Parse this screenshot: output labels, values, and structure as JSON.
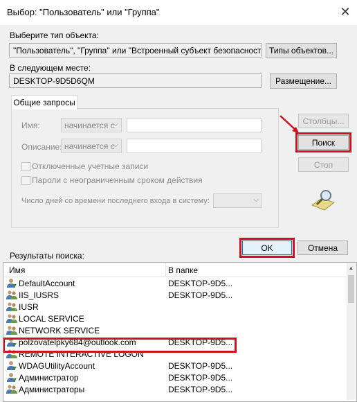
{
  "window": {
    "title": "Выбор: \"Пользователь\" или \"Группа\"",
    "close_glyph": "✕"
  },
  "object_type": {
    "label": "Выберите тип объекта:",
    "value": "\"Пользователь\", \"Группа\" или \"Встроенный субъект безопасности\"",
    "button": "Типы объектов..."
  },
  "location": {
    "label": "В следующем месте:",
    "value": "DESKTOP-9D5D6QM",
    "button": "Размещение..."
  },
  "queries": {
    "tab_label": "Общие запросы",
    "name_label": "Имя:",
    "name_mode": "начинается с",
    "description_label": "Описание:",
    "description_mode": "начинается с",
    "disabled_accounts": "Отключенные учетные записи",
    "non_expiring_passwords": "Пароли с неограниченным сроком действия",
    "days_since_logon": "Число дней со времени последнего входа в систему:",
    "dropdown_arrow": "⌵"
  },
  "side_buttons": {
    "columns": "Столбцы...",
    "search": "Поиск",
    "stop": "Стоп"
  },
  "dialog_buttons": {
    "ok": "OK",
    "cancel": "Отмена"
  },
  "results": {
    "label": "Результаты поиска:",
    "col_name": "Имя",
    "col_folder": "В папке",
    "rows": [
      {
        "name": "DefaultAccount",
        "folder": "DESKTOP-9D5...",
        "icon": "user-icon"
      },
      {
        "name": "IIS_IUSRS",
        "folder": "DESKTOP-9D5...",
        "icon": "group-icon"
      },
      {
        "name": "IUSR",
        "folder": "",
        "icon": "group-icon"
      },
      {
        "name": "LOCAL SERVICE",
        "folder": "",
        "icon": "group-icon"
      },
      {
        "name": "NETWORK SERVICE",
        "folder": "",
        "icon": "group-icon"
      },
      {
        "name": "polzovatelpky684@outlook.com",
        "folder": "DESKTOP-9D5...",
        "icon": "user-icon"
      },
      {
        "name": "REMOTE INTERACTIVE LOGON",
        "folder": "",
        "icon": "group-icon"
      },
      {
        "name": "WDAGUtilityAccount",
        "folder": "DESKTOP-9D5...",
        "icon": "user-icon"
      },
      {
        "name": "Администратор",
        "folder": "DESKTOP-9D5...",
        "icon": "user-icon"
      },
      {
        "name": "Администраторы",
        "folder": "DESKTOP-9D5...",
        "icon": "group-icon"
      }
    ]
  },
  "colors": {
    "highlight": "#d0101e",
    "window_bg": "#f0f0f0"
  }
}
